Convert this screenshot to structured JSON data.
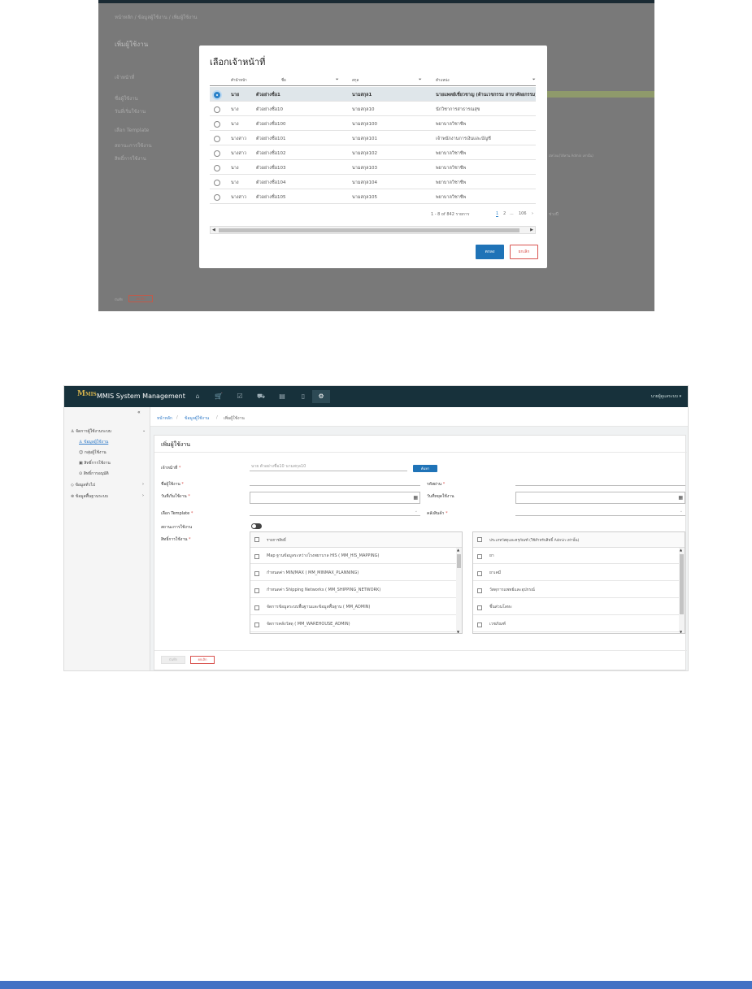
{
  "modal_screenshot": {
    "breadcrumb": [
      "หน้าหลัก",
      "ข้อมูลผู้ใช้งาน",
      "เพิ่มผู้ใช้งาน"
    ],
    "page_title": "เพิ่มผู้ใช้งาน",
    "bg_labels": [
      "เจ้าหน้าที่",
      "ชื่อผู้ใช้งาน",
      "วันที่เริ่มใช้งาน",
      "เลือก Template",
      "สถานะการใช้งาน",
      "สิทธิ์การใช้งาน"
    ],
    "bg_side_snippets": [
      "มัทโฮม(ไต้หวัน Admin เท่านั้น)",
      "ช่วงปี"
    ],
    "bg_buttons": {
      "save": "บันทึก",
      "cancel": "ยกเลิก"
    },
    "modal": {
      "title": "เลือกเจ้าหน้าที่",
      "columns": [
        "คำนำหน้า",
        "ชื่อ",
        "สกุล",
        "ตำแหน่ง"
      ],
      "rows": [
        {
          "prefix": "นาย",
          "first": "ตัวอย่างชื่อ1",
          "last": "นามสกุล1",
          "position": "นายแพทย์เชี่ยวชาญ (ด้านเวชกรรม สาขาศัลยกรรม)",
          "selected": true
        },
        {
          "prefix": "นาง",
          "first": "ตัวอย่างชื่อ10",
          "last": "นามสกุล10",
          "position": "นักวิชาการสาธารณสุข",
          "selected": false
        },
        {
          "prefix": "นาง",
          "first": "ตัวอย่างชื่อ100",
          "last": "นามสกุล100",
          "position": "พยาบาลวิชาชีพ",
          "selected": false
        },
        {
          "prefix": "นางสาว",
          "first": "ตัวอย่างชื่อ101",
          "last": "นามสกุล101",
          "position": "เจ้าพนักงานการเงินและบัญชี",
          "selected": false
        },
        {
          "prefix": "นางสาว",
          "first": "ตัวอย่างชื่อ102",
          "last": "นามสกุล102",
          "position": "พยาบาลวิชาชีพ",
          "selected": false
        },
        {
          "prefix": "นาง",
          "first": "ตัวอย่างชื่อ103",
          "last": "นามสกุล103",
          "position": "พยาบาลวิชาชีพ",
          "selected": false
        },
        {
          "prefix": "นาง",
          "first": "ตัวอย่างชื่อ104",
          "last": "นามสกุล104",
          "position": "พยาบาลวิชาชีพ",
          "selected": false
        },
        {
          "prefix": "นางสาว",
          "first": "ตัวอย่างชื่อ105",
          "last": "นามสกุล105",
          "position": "พยาบาลวิชาชีพ",
          "selected": false
        }
      ],
      "pager": {
        "range": "1 - 8 of 842 รายการ",
        "pages": [
          "1",
          "2",
          "...",
          "106",
          "›"
        ],
        "current_page": "1"
      },
      "ok_label": "ตกลง",
      "cancel_label": "ยกเลิก"
    }
  },
  "app": {
    "brand": "MMIS System Management",
    "logo_text": "MMIS",
    "nav_icons": [
      "home-icon",
      "cart-icon",
      "checklist-icon",
      "truck-icon",
      "database-icon",
      "document-icon",
      "gear-icon"
    ],
    "user_menu": "นายผู้ดูแลระบบ ▾",
    "collapse_glyph": "«",
    "sidebar": {
      "group1": "จัดการผู้ใช้งานระบบ",
      "items": [
        "ข้อมูลผู้ใช้งาน",
        "กลุ่มผู้ใช้งาน",
        "สิทธิ์การใช้งาน",
        "สิทธิ์การอนุมัติ"
      ],
      "group2": "ข้อมูลทั่วไป",
      "group3": "ข้อมูลพื้นฐานระบบ"
    },
    "breadcrumb": [
      "หน้าหลัก",
      "ข้อมูลผู้ใช้งาน",
      "เพิ่มผู้ใช้งาน"
    ],
    "form": {
      "title": "เพิ่มผู้ใช้งาน",
      "officer_label": "เจ้าหน้าที่",
      "officer_value": "นาย ตัวอย่างชื่อ10 นามสกุล10",
      "search_label": "ค้นหา",
      "username_label": "ชื่อผู้ใช้งาน",
      "password_label": "รหัสผ่าน",
      "start_label": "วันที่เริ่มใช้งาน",
      "end_label": "วันที่หยุดใช้งาน",
      "template_label": "เลือก Template",
      "warehouse_label": "คลังสินค้า",
      "status_label": "สถานะการใช้งาน",
      "perm_label": "สิทธิ์การใช้งาน",
      "left_list": {
        "header": "รายการสิทธิ์",
        "items": [
          "Map ฐานข้อมูลระหว่างโรงพยาบาล HIS ( MM_HIS_MAPPING)",
          "กำหนดค่า MIN/MAX ( MM_MINMAX_PLANNING)",
          "กำหนดค่า Shipping Networks ( MM_SHIPPING_NETWORK)",
          "จัดการข้อมูลระบบพื้นฐานและข้อมูลพื้นฐาน ( MM_ADMIN)",
          "จัดการคลังวัสดุ ( MM_WAREHOUSE_ADMIN)"
        ]
      },
      "right_list": {
        "header": "ประเภทวัสดุและครุภัณฑ์ (ใช้สำหรับสิทธิ์ Admin เท่านั้น)",
        "items": [
          "ยา",
          "ยาเคมี",
          "วัสดุการแพทย์และอุปกรณ์",
          "ชิ้นส่วนโลหะ",
          "เวชภัณฑ์"
        ]
      },
      "save_label": "บันทึก",
      "cancel_label": "ยกเลิก"
    }
  }
}
